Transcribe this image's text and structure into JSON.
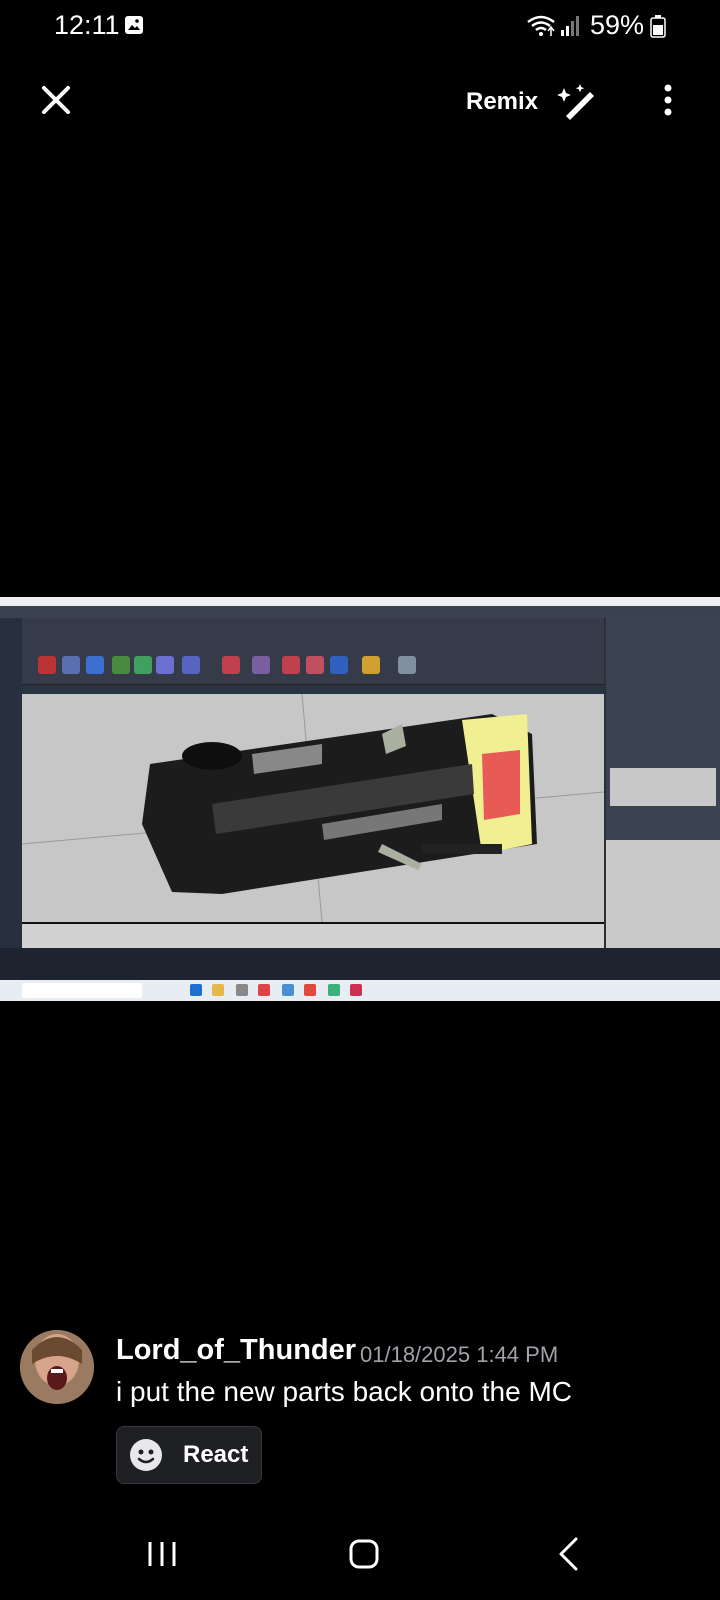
{
  "status_bar": {
    "time": "12:11",
    "battery_percent": "59%",
    "icons": [
      "gallery-icon",
      "wifi-icon",
      "signal-icon",
      "battery-icon"
    ]
  },
  "top_bar": {
    "close_icon": "close-icon",
    "remix_label": "Remix",
    "remix_icon": "magic-wand-icon",
    "more_icon": "more-vertical-icon"
  },
  "message": {
    "username": "Lord_of_Thunder",
    "timestamp": "01/18/2025 1:44 PM",
    "text": "i put the new parts back onto the MC",
    "react_label": "React",
    "react_icon": "emoji-icon"
  },
  "nav_bar": {
    "icons": [
      "recents-icon",
      "home-icon",
      "back-icon"
    ]
  },
  "colors": {
    "background": "#000000",
    "react_button_bg": "#1f2024",
    "timestamp": "#a0a3aa"
  }
}
